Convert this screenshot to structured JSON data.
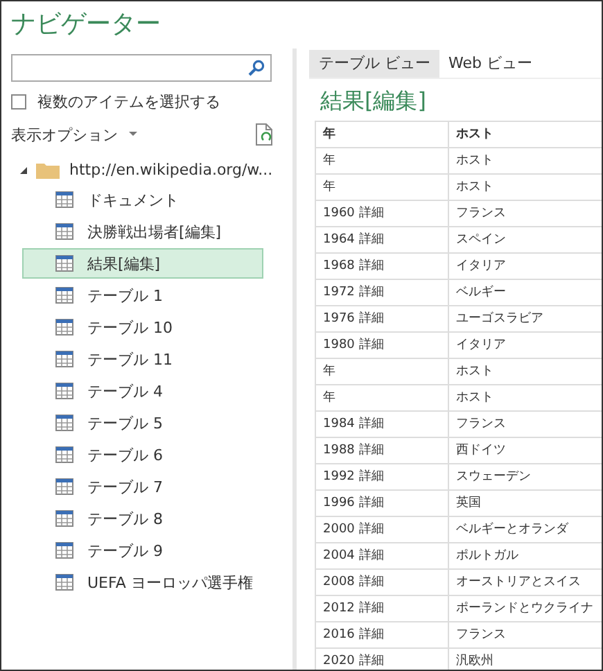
{
  "window": {
    "title": "ナビゲーター"
  },
  "select_multiple": {
    "label": "複数のアイテムを選択する",
    "checked": false
  },
  "display_options": {
    "label": "表示オプション"
  },
  "tree": [
    {
      "label": "http://en.wikipedia.org/w...",
      "expanded": true,
      "children": [
        {
          "label": "ドキュメント",
          "selected": false
        },
        {
          "label": "決勝戦出場者[編集]",
          "selected": false
        },
        {
          "label": "結果[編集]",
          "selected": true
        },
        {
          "label": "テーブル 1",
          "selected": false
        },
        {
          "label": "テーブル 10",
          "selected": false
        },
        {
          "label": "テーブル 11",
          "selected": false
        },
        {
          "label": "テーブル 4",
          "selected": false
        },
        {
          "label": "テーブル 5",
          "selected": false
        },
        {
          "label": "テーブル 6",
          "selected": false
        },
        {
          "label": "テーブル 7",
          "selected": false
        },
        {
          "label": "テーブル 8",
          "selected": false
        },
        {
          "label": "テーブル 9",
          "selected": false
        },
        {
          "label": "UEFA ヨーロッパ選手権",
          "selected": false
        }
      ]
    }
  ],
  "tabs": [
    {
      "label": "テーブル ビュー",
      "selected": true
    },
    {
      "label": "Web ビュー",
      "selected": false
    }
  ],
  "preview": {
    "title": "結果[編集]",
    "table": {
      "columns": [
        "年",
        "ホスト"
      ],
      "rows": [
        [
          "年",
          "ホスト"
        ],
        [
          "年",
          "ホスト"
        ],
        [
          "1960 詳細",
          "フランス"
        ],
        [
          "1964 詳細",
          "スペイン"
        ],
        [
          "1968 詳細",
          "イタリア"
        ],
        [
          "1972 詳細",
          "ベルギー"
        ],
        [
          "1976 詳細",
          "ユーゴスラビア"
        ],
        [
          "1980 詳細",
          "イタリア"
        ],
        [
          "年",
          "ホスト"
        ],
        [
          "年",
          "ホスト"
        ],
        [
          "1984 詳細",
          "フランス"
        ],
        [
          "1988 詳細",
          "西ドイツ"
        ],
        [
          "1992 詳細",
          "スウェーデン"
        ],
        [
          "1996 詳細",
          "英国"
        ],
        [
          "2000 詳細",
          "ベルギーとオランダ"
        ],
        [
          "2004 詳細",
          "ポルトガル"
        ],
        [
          "2008 詳細",
          "オーストリアとスイス"
        ],
        [
          "2012 詳細",
          "ポーランドとウクライナ"
        ],
        [
          "2016 詳細",
          "フランス"
        ],
        [
          "2020 詳細",
          "汎欧州"
        ]
      ]
    }
  }
}
